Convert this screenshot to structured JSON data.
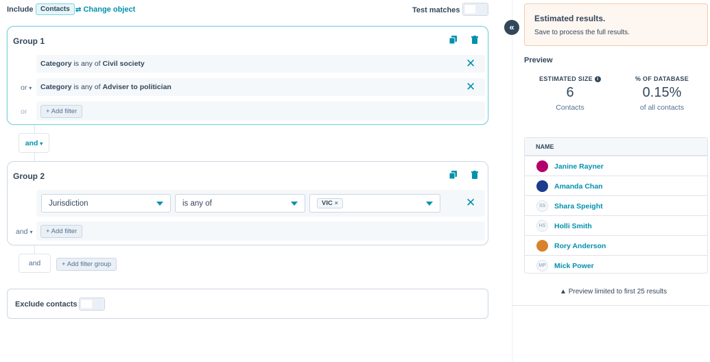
{
  "header": {
    "include_label": "Include",
    "object_chip": "Contacts",
    "change_object_icon": "swap-icon",
    "change_object_label": "Change object",
    "test_matches_label": "Test matches"
  },
  "group1": {
    "title": "Group 1",
    "filters": [
      {
        "prefix": "",
        "property": "Category",
        "operator": "is any of",
        "value": "Civil society"
      },
      {
        "prefix": "or",
        "property": "Category",
        "operator": "is any of",
        "value": "Adviser to politician"
      }
    ],
    "or_label": "or",
    "add_filter_label": "+ Add filter"
  },
  "between_groups": {
    "and_label": "and"
  },
  "group2": {
    "title": "Group 2",
    "property_select": "Jurisdiction",
    "operator_select": "is any of",
    "value_tag": "VIC",
    "and_label": "and",
    "add_filter_label": "+ Add filter"
  },
  "footer_actions": {
    "and_label": "and",
    "add_filter_group_label": "+ Add filter group"
  },
  "exclude": {
    "label": "Exclude contacts"
  },
  "panel": {
    "alert_title": "Estimated results.",
    "alert_body": "Save to process the full results.",
    "preview_label": "Preview",
    "estimated_size_label": "ESTIMATED SIZE",
    "estimated_size_value": "6",
    "estimated_size_unit": "Contacts",
    "pct_label": "% OF DATABASE",
    "pct_value": "0.15%",
    "pct_unit": "of all contacts",
    "table_header": "NAME",
    "rows": [
      {
        "name": "Janine Rayner",
        "avatar": "logo",
        "color": "#b3006b"
      },
      {
        "name": "Amanda Chan",
        "avatar": "logo",
        "color": "#1a3d8f"
      },
      {
        "name": "Shara Speight",
        "avatar": "SS",
        "color": ""
      },
      {
        "name": "Holli Smith",
        "avatar": "HS",
        "color": ""
      },
      {
        "name": "Rory Anderson",
        "avatar": "logo",
        "color": "#d9822b"
      },
      {
        "name": "Mick Power",
        "avatar": "MP",
        "color": ""
      }
    ],
    "limit_note": "Preview limited to first 25 results"
  },
  "colors": {
    "accent": "#0091ae",
    "text": "#33475b",
    "alert_bg": "#fef6f0"
  }
}
